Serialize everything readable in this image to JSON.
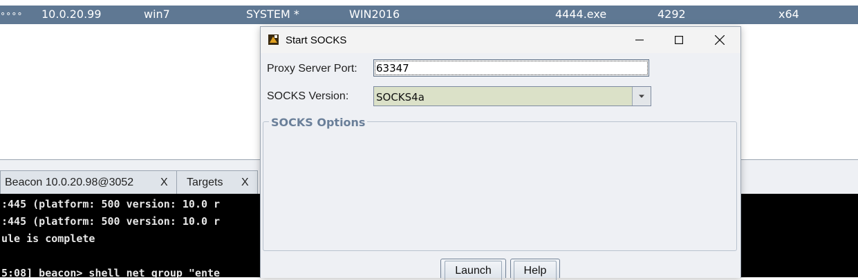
{
  "beacon_row": {
    "external": "∘∘∘∘",
    "internal": "10.0.20.99",
    "listener": "win7",
    "user": "SYSTEM *",
    "computer": "WIN2016",
    "process": "4444.exe",
    "pid": "4292",
    "arch": "x64"
  },
  "tabs": [
    {
      "label": "Beacon 10.0.20.98@3052",
      "close": "X"
    },
    {
      "label": "Targets",
      "close": "X"
    }
  ],
  "console": {
    "lines": [
      ":445 (platform: 500 version: 10.0 r",
      ":445 (platform: 500 version: 10.0 r",
      "ule is complete",
      "",
      "5:08] beacon> shell net group \"ente"
    ]
  },
  "dialog": {
    "title": "Start SOCKS",
    "port_label": "Proxy Server Port:",
    "port_value": "63347",
    "version_label": "SOCKS Version:",
    "version_value": "SOCKS4a",
    "options_legend": "SOCKS Options",
    "launch_label": "Launch",
    "help_label": "Help"
  },
  "colors": {
    "selected_row": "#5f7893",
    "console_bg": "#000000",
    "dialog_bg": "#eef0f4",
    "legend": "#6a7f99"
  }
}
